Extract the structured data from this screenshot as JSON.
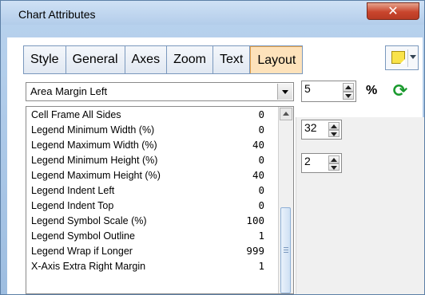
{
  "window": {
    "title": "Chart Attributes",
    "close_glyph": "✕"
  },
  "tabs": [
    {
      "label": "Style",
      "active": false
    },
    {
      "label": "General",
      "active": false
    },
    {
      "label": "Axes",
      "active": false
    },
    {
      "label": "Zoom",
      "active": false
    },
    {
      "label": "Text",
      "active": false
    },
    {
      "label": "Layout",
      "active": true
    }
  ],
  "attribute_select": {
    "value": "Area Margin Left"
  },
  "spinner_main": {
    "value": "5",
    "unit": "%"
  },
  "spinner_2": {
    "value": "32"
  },
  "spinner_3": {
    "value": "2"
  },
  "icons": {
    "note": "sticky-note-icon",
    "refresh": "refresh-icon",
    "refresh_color": "#1a9a2e"
  },
  "attribute_list": [
    {
      "label": "Cell Frame All Sides",
      "value": "0"
    },
    {
      "label": "Legend Minimum Width (%)",
      "value": "0"
    },
    {
      "label": "Legend Maximum Width (%)",
      "value": "40"
    },
    {
      "label": "Legend Minimum Height (%)",
      "value": "0"
    },
    {
      "label": "Legend Maximum Height (%)",
      "value": "40"
    },
    {
      "label": "Legend Indent Left",
      "value": "0"
    },
    {
      "label": "Legend Indent Top",
      "value": "0"
    },
    {
      "label": "Legend Symbol Scale (%)",
      "value": "100"
    },
    {
      "label": "Legend Symbol Outline",
      "value": "1"
    },
    {
      "label": "Legend Wrap if Longer",
      "value": "999"
    },
    {
      "label": "X-Axis Extra Right Margin",
      "value": "1"
    }
  ]
}
